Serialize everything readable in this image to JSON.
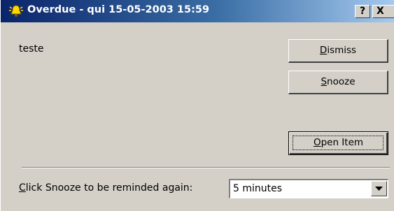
{
  "window": {
    "title": "Overdue - qui 15-05-2003 15:59",
    "help_label": "?",
    "close_label": "X",
    "icon": "bell-icon"
  },
  "message": "teste",
  "buttons": {
    "dismiss": {
      "accel": "D",
      "rest": "ismiss"
    },
    "snooze": {
      "accel": "S",
      "rest": "nooze"
    },
    "open_item": {
      "accel": "O",
      "rest": "pen Item"
    }
  },
  "snooze_prompt": {
    "accel": "C",
    "rest": "lick Snooze to be reminded again:"
  },
  "snooze_select": {
    "value": "5 minutes",
    "arrow_icon": "chevron-down-icon"
  },
  "colors": {
    "title_gradient_start": "#0a246a",
    "title_gradient_end": "#a6caf0",
    "face": "#d4d0c8"
  }
}
